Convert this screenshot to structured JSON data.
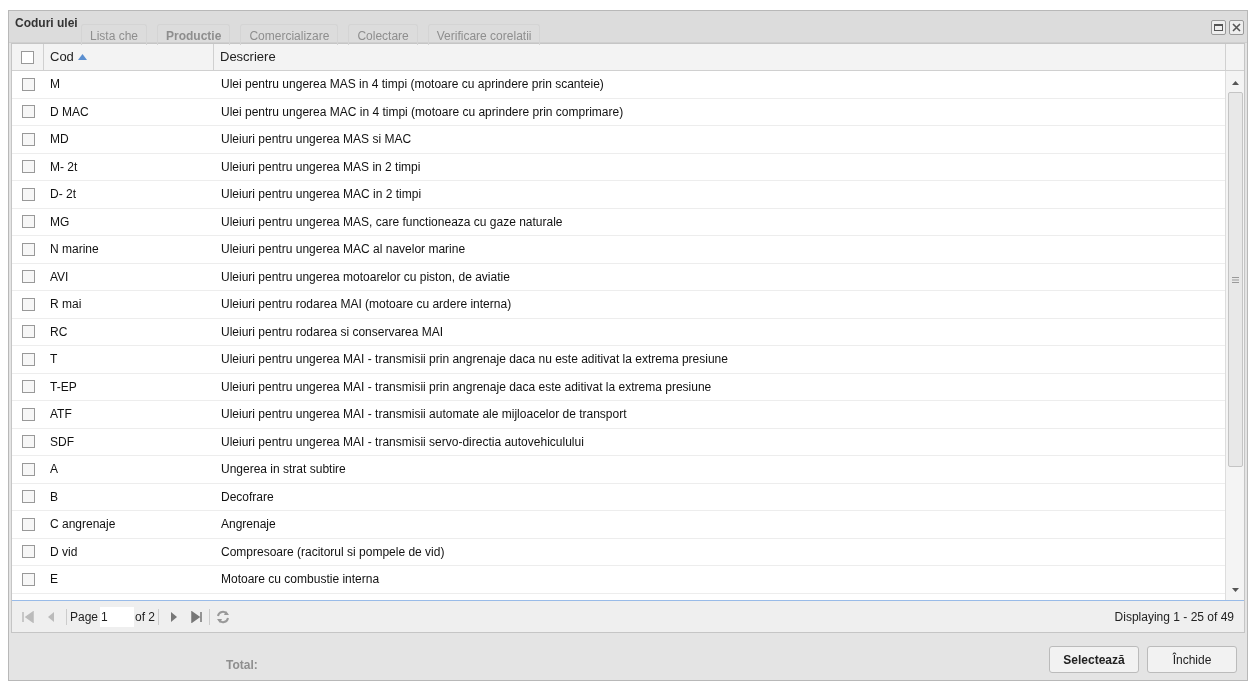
{
  "window": {
    "title": "Coduri ulei"
  },
  "background": {
    "tabs": [
      "Lista che",
      "Productie",
      "Comercializare",
      "Colectare",
      "Verificare corelatii"
    ],
    "total_label": "Total:"
  },
  "table": {
    "select_all_checked": false,
    "columns": [
      {
        "label": "Cod",
        "sorted_ascending": true
      },
      {
        "label": "Descriere",
        "sorted_ascending": false
      }
    ],
    "rows": [
      {
        "checked": false,
        "cod": "M",
        "descriere": "Ulei pentru ungerea MAS in 4 timpi (motoare cu aprindere prin scanteie)"
      },
      {
        "checked": false,
        "cod": "D MAC",
        "descriere": "Ulei pentru ungerea MAC in 4 timpi (motoare cu aprindere prin comprimare)"
      },
      {
        "checked": false,
        "cod": "MD",
        "descriere": "Uleiuri pentru ungerea MAS si MAC"
      },
      {
        "checked": false,
        "cod": "M- 2t",
        "descriere": "Uleiuri pentru ungerea MAS in 2 timpi"
      },
      {
        "checked": false,
        "cod": "D- 2t",
        "descriere": "Uleiuri pentru ungerea MAC in 2 timpi"
      },
      {
        "checked": false,
        "cod": "MG",
        "descriere": "Uleiuri pentru ungerea MAS, care functioneaza cu gaze naturale"
      },
      {
        "checked": false,
        "cod": "N marine",
        "descriere": "Uleiuri pentru ungerea MAC al navelor marine"
      },
      {
        "checked": false,
        "cod": "AVI",
        "descriere": "Uleiuri pentru ungerea motoarelor cu piston, de aviatie"
      },
      {
        "checked": false,
        "cod": "R mai",
        "descriere": "Uleiuri pentru rodarea MAI (motoare cu ardere interna)"
      },
      {
        "checked": false,
        "cod": "RC",
        "descriere": "Uleiuri pentru rodarea si conservarea MAI"
      },
      {
        "checked": false,
        "cod": "T",
        "descriere": "Uleiuri pentru ungerea MAI - transmisii prin angrenaje daca nu este aditivat la extrema presiune"
      },
      {
        "checked": false,
        "cod": "T-EP",
        "descriere": "Uleiuri pentru ungerea MAI - transmisii prin angrenaje daca este aditivat la extrema presiune"
      },
      {
        "checked": false,
        "cod": "ATF",
        "descriere": "Uleiuri pentru ungerea MAI - transmisii automate ale mijloacelor de transport"
      },
      {
        "checked": false,
        "cod": "SDF",
        "descriere": "Uleiuri pentru ungerea MAI - transmisii servo-directia autovehiculului"
      },
      {
        "checked": false,
        "cod": "A",
        "descriere": "Ungerea in strat subtire"
      },
      {
        "checked": false,
        "cod": "B",
        "descriere": "Decofrare"
      },
      {
        "checked": false,
        "cod": "C angrenaje",
        "descriere": "Angrenaje"
      },
      {
        "checked": false,
        "cod": "D vid",
        "descriere": "Compresoare (racitorul si pompele de vid)"
      },
      {
        "checked": false,
        "cod": "E",
        "descriere": "Motoare cu combustie interna"
      }
    ]
  },
  "pager": {
    "page_label": "Page",
    "page_value": "1",
    "of_label": "of 2",
    "display": "Displaying 1 - 25 of 49"
  },
  "buttons": [
    "Selectează",
    "Închide"
  ]
}
